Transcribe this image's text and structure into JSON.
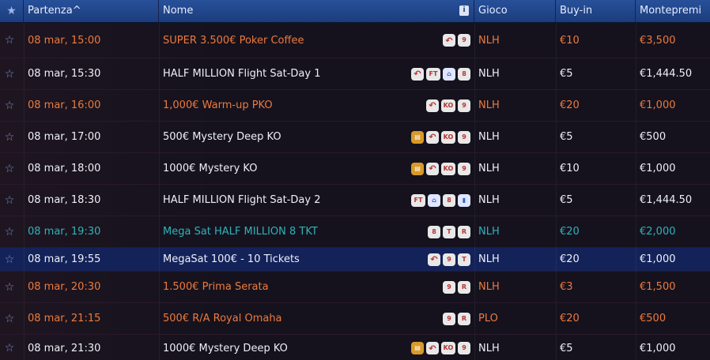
{
  "header": {
    "star_icon": "star-icon",
    "start_label": "Partenza^",
    "name_label": "Nome",
    "info_icon": "info-icon",
    "game_label": "Gioco",
    "buyin_label": "Buy-in",
    "prize_label": "Montepremi"
  },
  "colors": {
    "orange": "#ee7a3a",
    "white": "#eef0f6",
    "teal": "#2fb4b8",
    "selected_bg": "#14225a",
    "row_bg": "#15121e"
  },
  "rows": [
    {
      "start": "08 mar, 15:00",
      "name": "SUPER 3.500€ Poker Coffee",
      "game": "NLH",
      "buyin": "€10",
      "prize": "€3,500",
      "color": "orange",
      "icons": [
        "re-entry-icon",
        "9"
      ]
    },
    {
      "start": "08 mar, 15:30",
      "name": "HALF MILLION Flight Sat-Day 1",
      "game": "NLH",
      "buyin": "€5",
      "prize": "€1,444.50",
      "color": "white",
      "icons": [
        "re-entry-icon",
        "FT",
        "flight-icon",
        "8"
      ]
    },
    {
      "start": "08 mar, 16:00",
      "name": "1,000€ Warm-up PKO",
      "game": "NLH",
      "buyin": "€20",
      "prize": "€1,000",
      "color": "orange",
      "icons": [
        "re-entry-icon",
        "KO",
        "9"
      ]
    },
    {
      "start": "08 mar, 17:00",
      "name": "500€ Mystery Deep KO",
      "game": "NLH",
      "buyin": "€5",
      "prize": "€500",
      "color": "white",
      "icons": [
        "mystery-chest-icon",
        "re-entry-icon",
        "KO",
        "9"
      ]
    },
    {
      "start": "08 mar, 18:00",
      "name": "1000€ Mystery KO",
      "game": "NLH",
      "buyin": "€10",
      "prize": "€1,000",
      "color": "white",
      "icons": [
        "mystery-chest-icon",
        "re-entry-icon",
        "KO",
        "9"
      ]
    },
    {
      "start": "08 mar, 18:30",
      "name": "HALF MILLION Flight Sat-Day 2",
      "game": "NLH",
      "buyin": "€5",
      "prize": "€1,444.50",
      "color": "white",
      "icons": [
        "FT",
        "flight-icon",
        "8",
        "stats-icon"
      ]
    },
    {
      "start": "08 mar, 19:30",
      "name": "Mega Sat HALF MILLION 8 TKT",
      "game": "NLH",
      "buyin": "€20",
      "prize": "€2,000",
      "color": "teal",
      "icons": [
        "8",
        "T",
        "R"
      ]
    },
    {
      "start": "08 mar, 19:55",
      "name": "MegaSat 100€ - 10 Tickets",
      "game": "NLH",
      "buyin": "€20",
      "prize": "€1,000",
      "color": "white",
      "selected": true,
      "icons": [
        "re-entry-icon",
        "9",
        "T"
      ]
    },
    {
      "start": "08 mar, 20:30",
      "name": "1.500€ Prima Serata",
      "game": "NLH",
      "buyin": "€3",
      "prize": "€1,500",
      "color": "orange",
      "icons": [
        "9",
        "R"
      ]
    },
    {
      "start": "08 mar, 21:15",
      "name": "500€ R/A Royal Omaha",
      "game": "PLO",
      "buyin": "€20",
      "prize": "€500",
      "color": "orange",
      "icons": [
        "9",
        "R"
      ]
    },
    {
      "start": "08 mar, 21:30",
      "name": "1000€ Mystery Deep KO",
      "game": "NLH",
      "buyin": "€5",
      "prize": "€1,000",
      "color": "white",
      "icons": [
        "mystery-chest-icon",
        "re-entry-icon",
        "KO",
        "9"
      ]
    }
  ]
}
